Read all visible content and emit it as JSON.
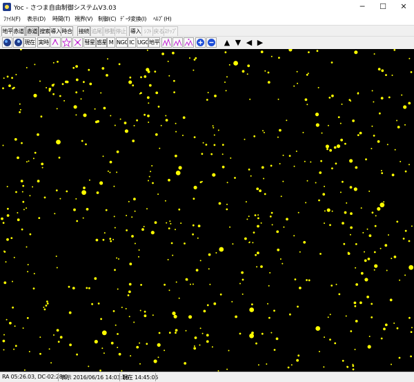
{
  "window": {
    "title": "Yoc - さつま自由制御システムV3.03",
    "minimize_glyph": "─",
    "maximize_glyph": "☐",
    "close_glyph": "✕"
  },
  "menu": [
    "ﾌｧｲﾙ(F)",
    "表示(D)",
    "時間(T)",
    "視界(V)",
    "制御(C)",
    "ﾃﾞｰﾀ変換(I)",
    "ﾍﾙﾌﾟ(H)"
  ],
  "toolbar1": [
    {
      "label": "地平",
      "state": "normal"
    },
    {
      "label": "赤道",
      "state": "normal"
    },
    {
      "label": "赤道",
      "state": "on"
    },
    {
      "label": "搜索",
      "state": "normal"
    },
    {
      "label": "導入",
      "state": "normal"
    },
    {
      "label": "時合",
      "state": "normal"
    },
    {
      "label": "接続",
      "state": "normal"
    },
    {
      "label": "追尾",
      "state": "disabled"
    },
    {
      "label": "移動",
      "state": "disabled"
    },
    {
      "label": "停止",
      "state": "disabled"
    },
    {
      "label": "導入",
      "state": "normal"
    },
    {
      "label": "ｼﾌﾄ",
      "state": "disabled"
    },
    {
      "label": "戻る",
      "state": "disabled"
    },
    {
      "label": "ｽﾃｯﾌﾟ",
      "state": "disabled"
    }
  ],
  "toolbar2": {
    "labels": {
      "now": "現在",
      "real": "実時",
      "comet": "彗星",
      "planet": "惑星",
      "m": "M",
      "ngc": "NGC",
      "ic": "IC",
      "ugc": "UGC",
      "ground": "地平"
    },
    "icons": [
      "earth-icon",
      "earth-icon",
      "satellite-icon",
      "constellation-line-icon",
      "constellation-name-icon",
      "star-magnitude-icon",
      "star-magnitude-icon",
      "star-magnitude-icon",
      "zoom-in-icon",
      "zoom-out-icon"
    ],
    "arrows": [
      "▲",
      "▼",
      "◀",
      "▶"
    ]
  },
  "status": {
    "coords": "RA 05:26.03, DC-02:28.0",
    "display_time": "表示 2016/06/16 14:03:16",
    "current_time": "現在 14:45:05"
  },
  "colors": {
    "sky": "#000000",
    "star": "#ffff00"
  }
}
